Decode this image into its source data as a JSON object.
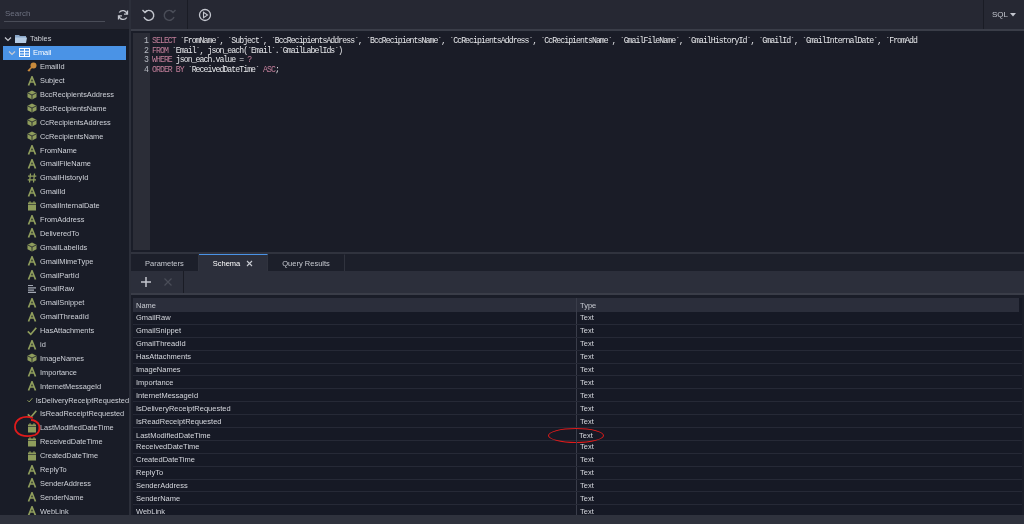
{
  "sidebar": {
    "search": {
      "placeholder": "Search"
    },
    "tree": [
      {
        "label": "Tables",
        "expanded": true,
        "selected": false,
        "children": [
          {
            "label": "Email",
            "expanded": true,
            "selected": true,
            "children": [
              {
                "label": "EmailId",
                "kind": "key",
                "selected": false,
                "circled": false
              },
              {
                "label": "Subject",
                "kind": "text",
                "selected": false,
                "circled": false
              },
              {
                "label": "BccRecipientsAddress",
                "kind": "object",
                "selected": false,
                "circled": false
              },
              {
                "label": "BccRecipientsName",
                "kind": "object",
                "selected": false,
                "circled": false
              },
              {
                "label": "CcRecipientsAddress",
                "kind": "object",
                "selected": false,
                "circled": false
              },
              {
                "label": "CcRecipientsName",
                "kind": "object",
                "selected": false,
                "circled": false
              },
              {
                "label": "FromName",
                "kind": "text",
                "selected": false,
                "circled": false
              },
              {
                "label": "GmailFileName",
                "kind": "text",
                "selected": false,
                "circled": false
              },
              {
                "label": "GmailHistoryId",
                "kind": "number",
                "selected": false,
                "circled": false
              },
              {
                "label": "GmailId",
                "kind": "text",
                "selected": false,
                "circled": false
              },
              {
                "label": "GmailInternalDate",
                "kind": "date",
                "selected": false,
                "circled": false
              },
              {
                "label": "FromAddress",
                "kind": "text",
                "selected": false,
                "circled": false
              },
              {
                "label": "DeliveredTo",
                "kind": "text",
                "selected": false,
                "circled": false
              },
              {
                "label": "GmailLabelIds",
                "kind": "object",
                "selected": false,
                "circled": false
              },
              {
                "label": "GmailMimeType",
                "kind": "text",
                "selected": false,
                "circled": false
              },
              {
                "label": "GmailPartId",
                "kind": "text",
                "selected": false,
                "circled": false
              },
              {
                "label": "GmailRaw",
                "kind": "longtext",
                "selected": false,
                "circled": false
              },
              {
                "label": "GmailSnippet",
                "kind": "text",
                "selected": false,
                "circled": false
              },
              {
                "label": "GmailThreadId",
                "kind": "text",
                "selected": false,
                "circled": false
              },
              {
                "label": "HasAttachments",
                "kind": "bool",
                "selected": false,
                "circled": false
              },
              {
                "label": "id",
                "kind": "text",
                "selected": false,
                "circled": false
              },
              {
                "label": "ImageNames",
                "kind": "object",
                "selected": false,
                "circled": false
              },
              {
                "label": "Importance",
                "kind": "text",
                "selected": false,
                "circled": false
              },
              {
                "label": "InternetMessageId",
                "kind": "text",
                "selected": false,
                "circled": false
              },
              {
                "label": "IsDeliveryReceiptRequested",
                "kind": "bool",
                "selected": false,
                "circled": false
              },
              {
                "label": "IsReadReceiptRequested",
                "kind": "bool",
                "selected": false,
                "circled": false
              },
              {
                "label": "LastModifiedDateTime",
                "kind": "date",
                "selected": false,
                "circled": true
              },
              {
                "label": "ReceivedDateTime",
                "kind": "date",
                "selected": false,
                "circled": false
              },
              {
                "label": "CreatedDateTime",
                "kind": "date",
                "selected": false,
                "circled": false
              },
              {
                "label": "ReplyTo",
                "kind": "text",
                "selected": false,
                "circled": false
              },
              {
                "label": "SenderAddress",
                "kind": "text",
                "selected": false,
                "circled": false
              },
              {
                "label": "SenderName",
                "kind": "text",
                "selected": false,
                "circled": false
              },
              {
                "label": "WebLink",
                "kind": "text",
                "selected": false,
                "circled": false
              }
            ]
          }
        ]
      }
    ]
  },
  "toolbar": {
    "buttons": [
      {
        "kind": "undo",
        "disabled": false
      },
      {
        "kind": "redo",
        "disabled": true
      },
      {
        "kind": "run",
        "disabled": false
      }
    ],
    "language": "SQL"
  },
  "editor": {
    "lines": [
      {
        "number": "1",
        "tokens": [
          {
            "kind": "keyword",
            "text": "SELECT"
          },
          {
            "kind": "plain",
            "text": " `FromName`, `Subject`, `BccRecipientsAddress`, `BccRecipientsName`, `CcRecipientsAddress`, `CcRecipientsName`, `GmailFileName`, `GmailHistoryId`, `GmailId`, `GmailInternalDate`, `FromAdd"
          }
        ]
      },
      {
        "number": "2",
        "tokens": [
          {
            "kind": "keyword",
            "text": "FROM"
          },
          {
            "kind": "plain",
            "text": " `Email`, json_each(`Email`.`GmailLabelIds`)"
          }
        ]
      },
      {
        "number": "3",
        "tokens": [
          {
            "kind": "keyword",
            "text": "WHERE"
          },
          {
            "kind": "plain",
            "text": " json_each.value = "
          },
          {
            "kind": "param",
            "text": "?"
          }
        ]
      },
      {
        "number": "4",
        "tokens": [
          {
            "kind": "keyword",
            "text": "ORDER BY"
          },
          {
            "kind": "plain",
            "text": " `ReceivedDateTime` "
          },
          {
            "kind": "keyword",
            "text": "ASC"
          },
          {
            "kind": "plain",
            "text": ";"
          }
        ]
      }
    ]
  },
  "tabs": [
    {
      "label": "Parameters",
      "selected": false,
      "closable": false
    },
    {
      "label": "Schema",
      "selected": true,
      "closable": true
    },
    {
      "label": "Query Results",
      "selected": false,
      "closable": false
    }
  ],
  "schema": {
    "actions": [
      {
        "kind": "add",
        "disabled": false
      },
      {
        "kind": "remove",
        "disabled": true
      }
    ],
    "columns": [
      "Name",
      "Type"
    ],
    "rows": [
      {
        "name": "GmailRaw",
        "type": "Text",
        "circled": false
      },
      {
        "name": "GmailSnippet",
        "type": "Text",
        "circled": false
      },
      {
        "name": "GmailThreadId",
        "type": "Text",
        "circled": false
      },
      {
        "name": "HasAttachments",
        "type": "Text",
        "circled": false
      },
      {
        "name": "ImageNames",
        "type": "Text",
        "circled": false
      },
      {
        "name": "Importance",
        "type": "Text",
        "circled": false
      },
      {
        "name": "InternetMessageId",
        "type": "Text",
        "circled": false
      },
      {
        "name": "IsDeliveryReceiptRequested",
        "type": "Text",
        "circled": false
      },
      {
        "name": "IsReadReceiptRequested",
        "type": "Text",
        "circled": false
      },
      {
        "name": "LastModifiedDateTime",
        "type": "Text",
        "circled": true
      },
      {
        "name": "ReceivedDateTime",
        "type": "Text",
        "circled": false
      },
      {
        "name": "CreatedDateTime",
        "type": "Text",
        "circled": false
      },
      {
        "name": "ReplyTo",
        "type": "Text",
        "circled": false
      },
      {
        "name": "SenderAddress",
        "type": "Text",
        "circled": false
      },
      {
        "name": "SenderName",
        "type": "Text",
        "circled": false
      },
      {
        "name": "WebLink",
        "type": "Text",
        "circled": false
      }
    ]
  }
}
